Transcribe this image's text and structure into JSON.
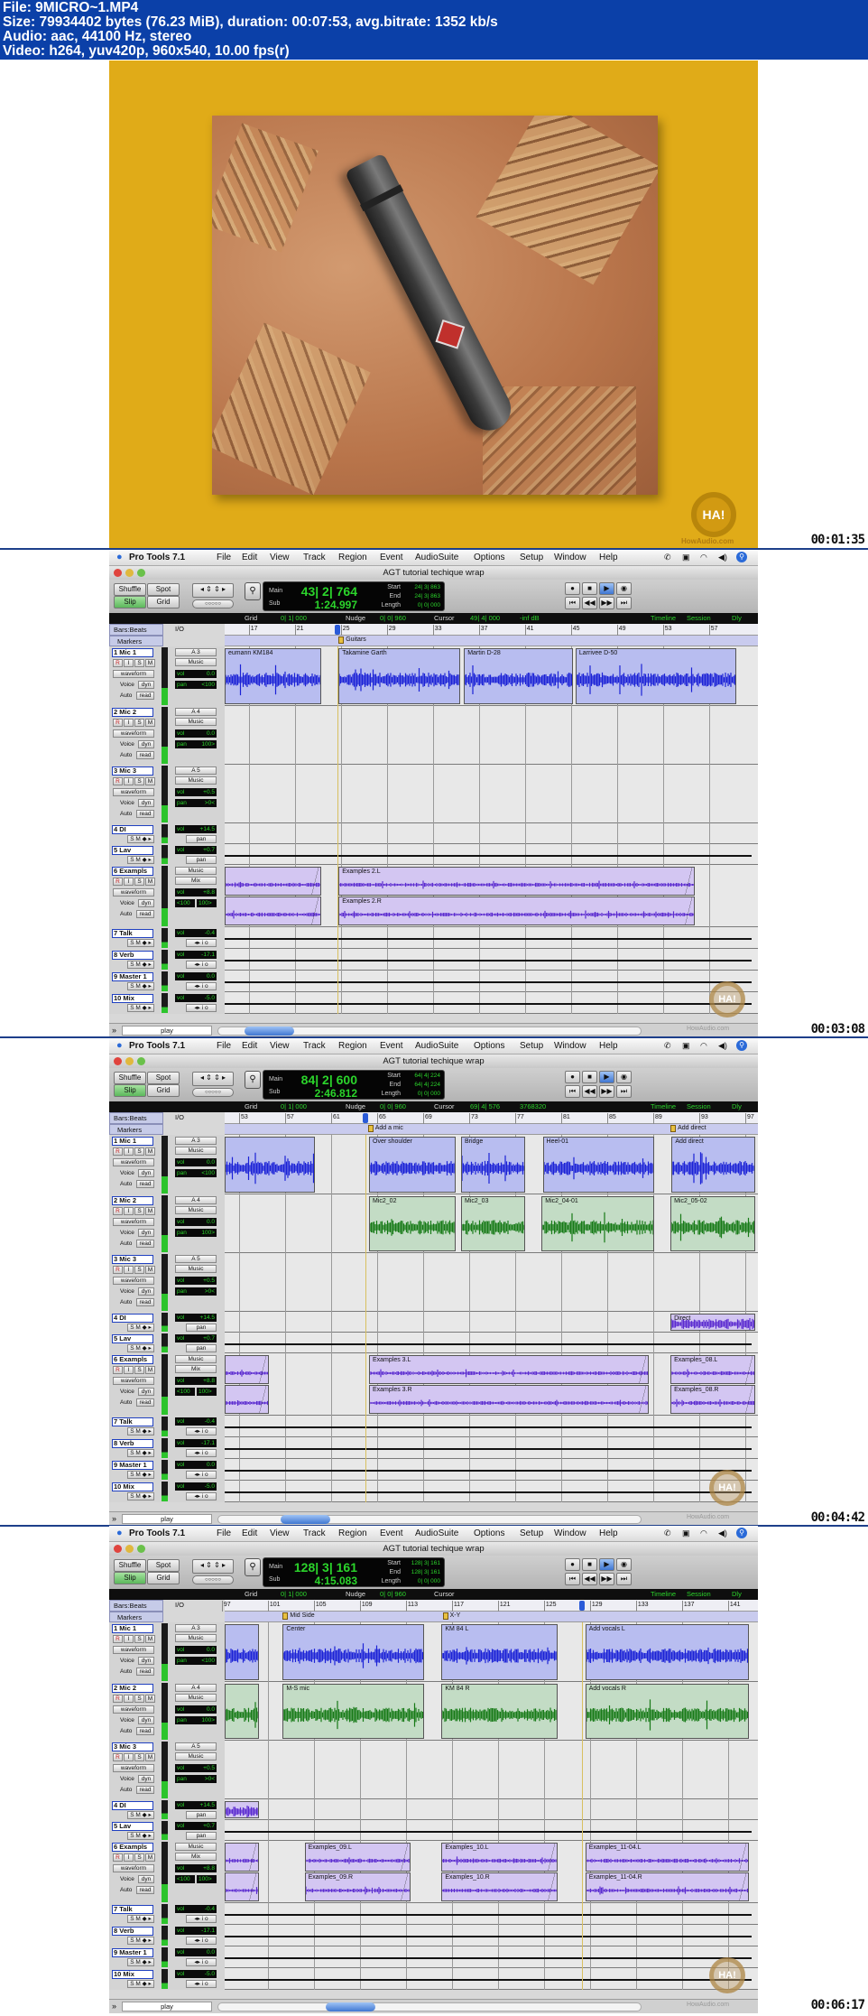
{
  "file_info": {
    "file": "File: 9MICRO~1.MP4",
    "size": "Size: 79934402 bytes (76.23 MiB), duration: 00:07:53, avg.bitrate: 1352 kb/s",
    "audio": "Audio: aac, 44100 Hz, stereo",
    "video": "Video: h264, yuv420p, 960x540, 10.00 fps(r)"
  },
  "logo": {
    "text": "HA!",
    "site": "HowAudio.com"
  },
  "colors": {
    "header": "#0b40a8",
    "photo_bg": "#e0ab18",
    "mic1_region": "#b8bdf0",
    "mic1_wave": "#1b22d6",
    "mic2_region": "#c3dcc5",
    "mic2_wave": "#177a17",
    "example_region": "#d3c6f2",
    "example_wave": "#5b2bd0",
    "counter_green": "#2bd42b"
  },
  "photo_frame": {
    "timestamp": "00:01:35"
  },
  "daw": {
    "app": "Pro Tools 7.1",
    "menu": [
      "File",
      "Edit",
      "View",
      "Track",
      "Region",
      "Event",
      "AudioSuite",
      "Options",
      "Setup",
      "Window",
      "Help"
    ],
    "window_title": "AGT tutorial techique wrap",
    "modes": {
      "shuffle": "Shuffle",
      "spot": "Spot",
      "slip": "Slip",
      "grid": "Grid"
    },
    "counter_labels": {
      "main": "Main",
      "sub": "Sub",
      "start": "Start",
      "end": "End",
      "length": "Length"
    },
    "editbar_labels": {
      "grid": "Grid",
      "nudge": "Nudge",
      "cursor": "Cursor",
      "timeline": "Timeline",
      "session": "Session",
      "dly": "Dly Comp"
    },
    "ruler_labels": {
      "bars": "Bars:Beats",
      "markers": "Markers",
      "io": "I/O"
    },
    "controls": {
      "waveform": "waveform",
      "voice": "Voice",
      "dyn": "dyn",
      "auto": "Auto",
      "read": "read",
      "vol": "vol",
      "pan": "pan",
      "play": "play",
      "r": "R",
      "i": "I",
      "s": "S",
      "m": "M"
    },
    "tracks": [
      {
        "name": "1 Mic 1",
        "out": "A 3",
        "bus": "Music",
        "vol": "0.0",
        "pan": "<100"
      },
      {
        "name": "2 Mic 2",
        "out": "A 4",
        "bus": "Music",
        "vol": "0.0",
        "pan": "100>"
      },
      {
        "name": "3 Mic 3",
        "out": "A 5",
        "bus": "Music",
        "vol": "+0.5",
        "pan": ">0<"
      },
      {
        "name": "4 DI",
        "vol": "+14.5",
        "pan": "pan"
      },
      {
        "name": "5 Lav",
        "vol": "+0.7",
        "pan": "pan"
      },
      {
        "name": "6 Exampls",
        "out": "Music",
        "bus": "Mix",
        "vol": "+8.8",
        "pan": "<100",
        "pan2": "100>"
      },
      {
        "name": "7 Talk",
        "vol": "-0.4"
      },
      {
        "name": "8 Verb",
        "vol": "-17.1"
      },
      {
        "name": "9 Master 1",
        "vol": "0.0"
      },
      {
        "name": "10 Mix",
        "vol": "-5.0"
      }
    ]
  },
  "daw_frames": [
    {
      "timestamp": "00:03:08",
      "counter": {
        "main": "43| 2| 764",
        "sub": "1:24.997",
        "start": "24| 3| 863",
        "end": "24| 3| 863",
        "length": "0| 0| 000"
      },
      "editbar": {
        "grid": "0| 1| 000",
        "nudge": "0| 0| 960",
        "cursor": "49| 4| 000",
        "extra": "-inf dB"
      },
      "view_start_bar": 14.9,
      "ruler": [
        "17",
        "21",
        "25",
        "29",
        "33",
        "37",
        "41",
        "45",
        "49",
        "53",
        "57"
      ],
      "playhead_bar": 24.7,
      "markers": [
        {
          "label": "Guitars",
          "bar": 24.8
        }
      ],
      "regions": [
        {
          "track": 0,
          "name": "eumann KM184",
          "start": 14.9,
          "end": 23.3
        },
        {
          "track": 0,
          "name": "Takamine Garth",
          "start": 24.8,
          "end": 35.4
        },
        {
          "track": 0,
          "name": "Martin D-28",
          "start": 35.7,
          "end": 45.2
        },
        {
          "track": 0,
          "name": "Larrivee D-50",
          "start": 45.4,
          "end": 59.4
        },
        {
          "track": 5,
          "name": "",
          "name_r": "",
          "start": 14.9,
          "end": 23.3
        },
        {
          "track": 5,
          "name": "Examples 2.L",
          "name_r": "Examples 2.R",
          "start": 24.8,
          "end": 55.8
        }
      ]
    },
    {
      "timestamp": "00:04:42",
      "counter": {
        "main": "84| 2| 600",
        "sub": "2:46.812",
        "start": "64| 4| 224",
        "end": "64| 4| 224",
        "length": "0| 0| 000"
      },
      "editbar": {
        "grid": "0| 1| 000",
        "nudge": "0| 0| 960",
        "cursor": "69| 4| 576",
        "extra": "3768320"
      },
      "view_start_bar": 51.75,
      "ruler": [
        "53",
        "57",
        "61",
        "65",
        "69",
        "73",
        "77",
        "81",
        "85",
        "89",
        "93",
        "97"
      ],
      "playhead_bar": 64.0,
      "markers": [
        {
          "label": "Add a mic",
          "bar": 64.2
        },
        {
          "label": "Add direct",
          "bar": 90.5
        }
      ],
      "regions": [
        {
          "track": 0,
          "name": "",
          "start": 51.75,
          "end": 59.6
        },
        {
          "track": 0,
          "name": "Over shoulder",
          "start": 64.3,
          "end": 71.8
        },
        {
          "track": 0,
          "name": "Bridge",
          "start": 72.3,
          "end": 77.9
        },
        {
          "track": 0,
          "name": "Heel-01",
          "start": 79.4,
          "end": 89.1
        },
        {
          "track": 0,
          "name": "Add direct",
          "start": 90.6,
          "end": 99
        },
        {
          "track": 1,
          "name": "Mic2_02",
          "start": 64.3,
          "end": 71.8
        },
        {
          "track": 1,
          "name": "Mic2_03",
          "start": 72.3,
          "end": 77.9
        },
        {
          "track": 1,
          "name": "Mic2_04-01",
          "start": 79.3,
          "end": 89.1
        },
        {
          "track": 1,
          "name": "Mic2_05-02",
          "start": 90.5,
          "end": 99
        },
        {
          "track": 3,
          "name": "Direct",
          "start": 90.5,
          "end": 99
        },
        {
          "track": 5,
          "name": "",
          "name_r": "",
          "start": 51.75,
          "end": 55.6
        },
        {
          "track": 5,
          "name": "Examples 3.L",
          "name_r": "Examples 3.R",
          "start": 64.3,
          "end": 88.6
        },
        {
          "track": 5,
          "name": "Examples_08.L",
          "name_r": "Examples_08.R",
          "start": 90.5,
          "end": 99
        }
      ]
    },
    {
      "timestamp": "00:06:17",
      "counter": {
        "main": "128| 3| 161",
        "sub": "4:15.083",
        "start": "128| 3| 161",
        "end": "128| 3| 161",
        "length": "0| 0| 000"
      },
      "editbar": {
        "grid": "0| 1| 000",
        "nudge": "0| 0| 960",
        "cursor": "",
        "extra": ""
      },
      "view_start_bar": 97.25,
      "ruler": [
        "97",
        "101",
        "105",
        "109",
        "113",
        "117",
        "121",
        "125",
        "129",
        "133",
        "137",
        "141"
      ],
      "playhead_bar": 128.3,
      "markers": [
        {
          "label": "Mid Side",
          "bar": 102.3
        },
        {
          "label": "X-Y",
          "bar": 116.2
        }
      ],
      "regions": [
        {
          "track": 0,
          "name": "",
          "start": 97.25,
          "end": 100.2
        },
        {
          "track": 0,
          "name": "Center",
          "start": 102.3,
          "end": 114.6
        },
        {
          "track": 0,
          "name": "KM 84 L",
          "start": 116.1,
          "end": 126.2
        },
        {
          "track": 0,
          "name": "Add vocals L",
          "start": 128.6,
          "end": 142.8
        },
        {
          "track": 1,
          "name": "",
          "start": 97.25,
          "end": 100.2
        },
        {
          "track": 1,
          "name": "M-S mic",
          "start": 102.3,
          "end": 114.6
        },
        {
          "track": 1,
          "name": "KM 84 R",
          "start": 116.1,
          "end": 126.2
        },
        {
          "track": 1,
          "name": "Add vocals R",
          "start": 128.6,
          "end": 142.8
        },
        {
          "track": 3,
          "name": "",
          "start": 97.25,
          "end": 100.2
        },
        {
          "track": 5,
          "name": "",
          "name_r": "",
          "start": 97.25,
          "end": 100.2
        },
        {
          "track": 5,
          "name": "Examples_09.L",
          "name_r": "Examples_09.R",
          "start": 104.2,
          "end": 113.4
        },
        {
          "track": 5,
          "name": "Examples_10.L",
          "name_r": "Examples_10.R",
          "start": 116.1,
          "end": 126.2
        },
        {
          "track": 5,
          "name": "Examples_11-04.L",
          "name_r": "Examples_11-04.R",
          "start": 128.6,
          "end": 142.8
        }
      ]
    }
  ]
}
